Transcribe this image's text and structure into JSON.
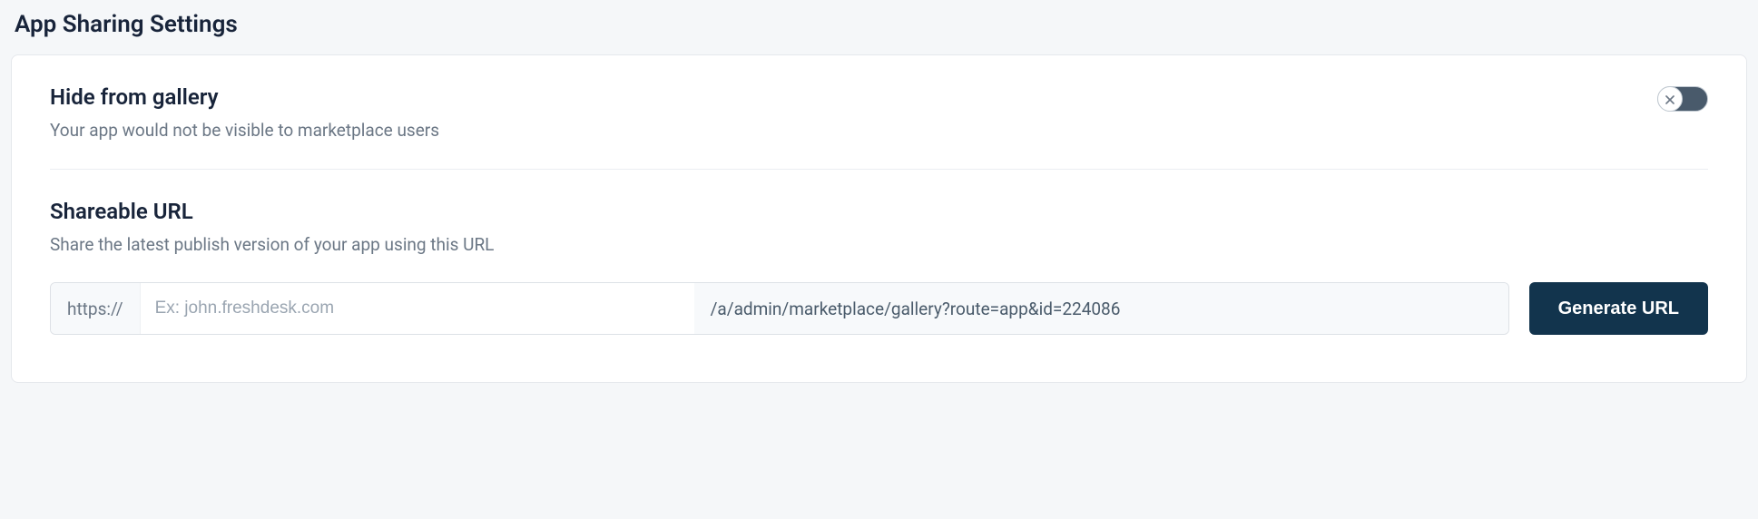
{
  "page": {
    "title": "App Sharing Settings"
  },
  "hide_from_gallery": {
    "title": "Hide from gallery",
    "description": "Your app would not be visible to marketplace users",
    "toggle_on": false
  },
  "shareable_url": {
    "title": "Shareable URL",
    "description": "Share the latest publish version of your app using this URL",
    "protocol_prefix": "https://",
    "domain_placeholder": "Ex: john.freshdesk.com",
    "domain_value": "",
    "path_suffix": "/a/admin/marketplace/gallery?route=app&id=224086",
    "generate_button": "Generate URL"
  }
}
